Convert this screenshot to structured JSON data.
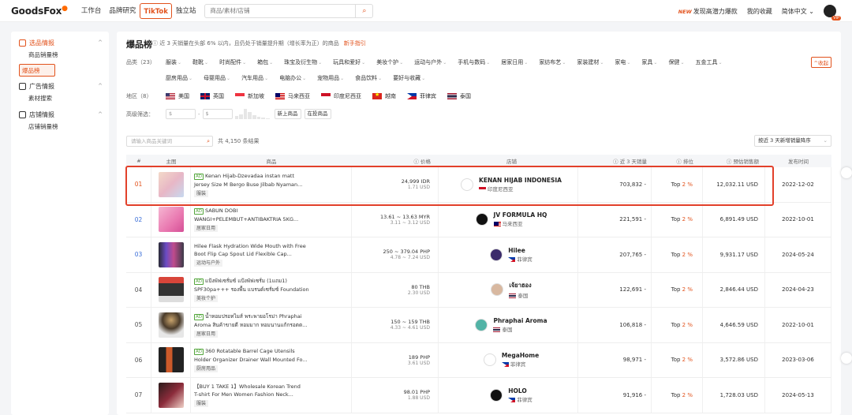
{
  "header": {
    "logo": "GoodsFox",
    "nav": [
      "工作台",
      "品牌研究",
      "TikTok",
      "独立站"
    ],
    "search_placeholder": "商品/素材/店铺",
    "new_badge": "NEW",
    "right_links": [
      "发现高潜力爆款",
      "我的收藏",
      "简体中文"
    ],
    "vip": "VIP"
  },
  "sidebar": {
    "groups": [
      {
        "title": "选品情报",
        "items": [
          "商品销量榜",
          "爆品榜"
        ]
      },
      {
        "title": "广告情报",
        "items": [
          "素材搜索"
        ]
      },
      {
        "title": "店铺情报",
        "items": [
          "店铺销量榜"
        ]
      }
    ]
  },
  "page": {
    "title": "爆品榜",
    "desc": "近 3 天销量在头部 6% 以内，且仍处于销量提升期（增长率为正）的商品",
    "guide_link": "新手指引",
    "collapse": "^收起"
  },
  "filters": {
    "category_label": "品类（23）",
    "categories_row1": [
      "服装",
      "鞋靴",
      "时尚配件",
      "箱包",
      "珠宝及衍生物",
      "玩具和爱好",
      "美妆个护",
      "运动与户外",
      "手机与数码",
      "居家日用",
      "家纺布艺",
      "家装建材",
      "家电",
      "家具",
      "保健",
      "五金工具"
    ],
    "categories_row2": [
      "厨房用品",
      "母婴用品",
      "汽车用品",
      "电脑办公",
      "宠物用品",
      "食品饮料",
      "要好与收藏"
    ],
    "region_label": "地区（8）",
    "regions": [
      {
        "flag": "us",
        "name": "美国"
      },
      {
        "flag": "uk",
        "name": "英国"
      },
      {
        "flag": "sg",
        "name": "新加坡"
      },
      {
        "flag": "my",
        "name": "马来西亚"
      },
      {
        "flag": "id",
        "name": "印度尼西亚"
      },
      {
        "flag": "vn",
        "name": "越南"
      },
      {
        "flag": "ph",
        "name": "菲律宾"
      },
      {
        "flag": "th",
        "name": "泰国"
      }
    ],
    "advanced_label": "高级筛选：",
    "price_from": "$",
    "price_to": "$",
    "chips": [
      "新上商品",
      "在投商品"
    ]
  },
  "list": {
    "search_placeholder": "请输入商品关键词",
    "result_count": "共 4,150 条结果",
    "sort": "按近 3 天新增销量降序",
    "headers": [
      "#",
      "主图",
      "商品",
      "价格",
      "店铺",
      "近 3 天销量",
      "排位",
      "预估销售额",
      "发布时间"
    ],
    "rows": [
      {
        "no": "01",
        "ad": true,
        "title1": "Kenan Hijab-Dzevadaa instan matt",
        "title2": "Jersey Size M Bergo Buse Jilbab Nyaman...",
        "tag": "服装",
        "price": "24,999 IDR",
        "price_usd": "1.71 USD",
        "shop": "KENAN HIJAB INDONESIA",
        "region": "印度尼西亚",
        "flag": "id",
        "sales": "703,832 -",
        "rank": "Top",
        "pct": "2 %",
        "amount": "12,032.11 USD",
        "date": "2022-12-02"
      },
      {
        "no": "02",
        "ad": true,
        "title1": "SABUN DOBI",
        "title2": "WANGI+PELEMBUT+ANTIBAKTRIA 5KG...",
        "tag": "居家日用",
        "price": "13.61 ~ 13.63 MYR",
        "price_usd": "3.11 ~ 3.12 USD",
        "shop": "JV FORMULA HQ",
        "region": "马来西亚",
        "flag": "my",
        "sales": "221,591 -",
        "rank": "Top",
        "pct": "2 %",
        "amount": "6,891.49 USD",
        "date": "2022-10-01"
      },
      {
        "no": "03",
        "ad": false,
        "title1": "Hilee Flask Hydration Wide Mouth with Free",
        "title2": "Boot Flip Cap Spout Lid Flexible Cap...",
        "tag": "运动与户外",
        "price": "250 ~ 379.04 PHP",
        "price_usd": "4.78 ~ 7.24 USD",
        "shop": "Hilee",
        "region": "菲律宾",
        "flag": "ph",
        "sales": "207,765 -",
        "rank": "Top",
        "pct": "2 %",
        "amount": "9,931.17 USD",
        "date": "2024-05-24"
      },
      {
        "no": "04",
        "ad": true,
        "title1": "แป้งพัฟเซรั่มซ์ แป้งพัฟเซรั่ม (1แถม1)",
        "title2": "SPF30pa+++ รองพื้น แบรนด์เซรั่มซ์ Foundation",
        "tag": "美妆个护",
        "price": "80 THB",
        "price_usd": "2.30 USD",
        "shop": "เจ้ยาฮอง",
        "region": "泰国",
        "flag": "th",
        "sales": "122,691 -",
        "rank": "Top",
        "pct": "2 %",
        "amount": "2,846.44 USD",
        "date": "2024-04-23"
      },
      {
        "no": "05",
        "ad": true,
        "title1": "น้ำหอมปรอทไมส์ พระพายอโรม่า Phraphai",
        "title2": "Aroma สินค้าขายดี หอมมาก หอมนานแก้กรอตต...",
        "tag": "居家日用",
        "price": "150 ~ 159 THB",
        "price_usd": "4.33 ~ 4.61 USD",
        "shop": "Phraphai Aroma",
        "region": "泰国",
        "flag": "th",
        "sales": "106,818 -",
        "rank": "Top",
        "pct": "2 %",
        "amount": "4,646.59 USD",
        "date": "2022-10-01"
      },
      {
        "no": "06",
        "ad": true,
        "title1": "360 Rotatable Barrel Cage Utensils",
        "title2": "Holder Organizer Drainer Wall Mounted Fo...",
        "tag": "厨房用品",
        "price": "189 PHP",
        "price_usd": "3.61 USD",
        "shop": "MegaHome",
        "region": "菲律宾",
        "flag": "ph",
        "sales": "98,971 -",
        "rank": "Top",
        "pct": "2 %",
        "amount": "3,572.86 USD",
        "date": "2023-03-06"
      },
      {
        "no": "07",
        "ad": false,
        "title1": "【BUY 1 TAKE 1】Wholesale Korean Trend",
        "title2": "T-shirt For Men Women Fashion Neck...",
        "tag": "服装",
        "price": "98.01 PHP",
        "price_usd": "1.88 USD",
        "shop": "HOLO",
        "region": "菲律宾",
        "flag": "ph",
        "sales": "91,916 -",
        "rank": "Top",
        "pct": "2 %",
        "amount": "1,728.03 USD",
        "date": "2024-05-13"
      }
    ]
  },
  "colors": {
    "accent": "#e2521c",
    "highlight": "#e2402a"
  }
}
